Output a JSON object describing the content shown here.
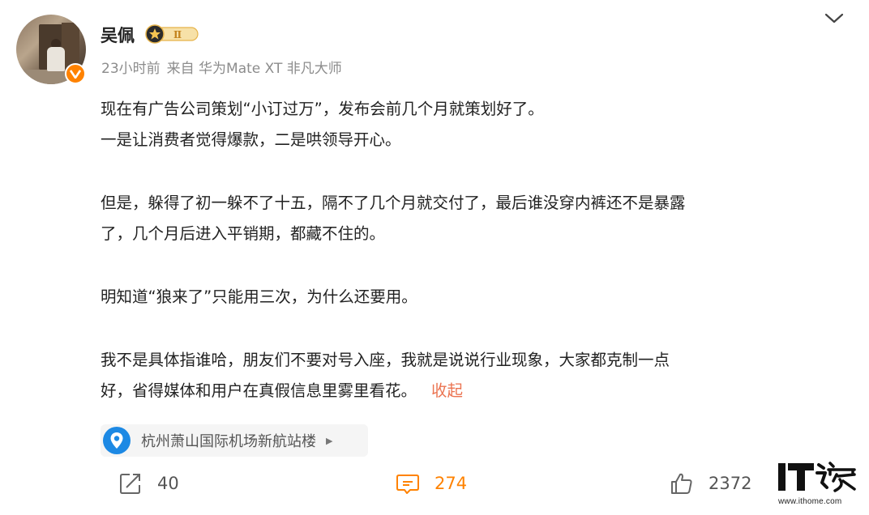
{
  "author": {
    "name": "吴佩",
    "vip_level": "Ⅱ"
  },
  "meta": {
    "time": "23小时前",
    "source": "来自 华为Mate XT 非凡大师"
  },
  "post": {
    "paragraphs": [
      [
        "现在有广告公司策划“小订过万”，发布会前几个月就策划好了。",
        "一是让消费者觉得爆款，二是哄领导开心。"
      ],
      [
        "但是，躲得了初一躲不了十五，隔不了几个月就交付了，最后谁没穿内裤还不是暴露",
        "了，几个月后进入平销期，都藏不住的。"
      ],
      [
        "明知道“狼来了”只能用三次，为什么还要用。"
      ],
      [
        "我不是具体指谁哈，朋友们不要对号入座，我就是说说行业现象，大家都克制一点",
        "好，省得媒体和用户在真假信息里雾里看花。"
      ]
    ],
    "collapse_label": "收起"
  },
  "location": {
    "name": "杭州萧山国际机场新航站楼"
  },
  "actions": {
    "repost_count": "40",
    "comment_count": "274",
    "like_count": "2372"
  },
  "watermark": {
    "logo_text": "IT之家",
    "url": "www.ithome.com"
  },
  "colors": {
    "accent": "#ff8200",
    "link": "#eb7350",
    "location_icon": "#1d89e4",
    "vip_gold": "#e6b34a"
  }
}
